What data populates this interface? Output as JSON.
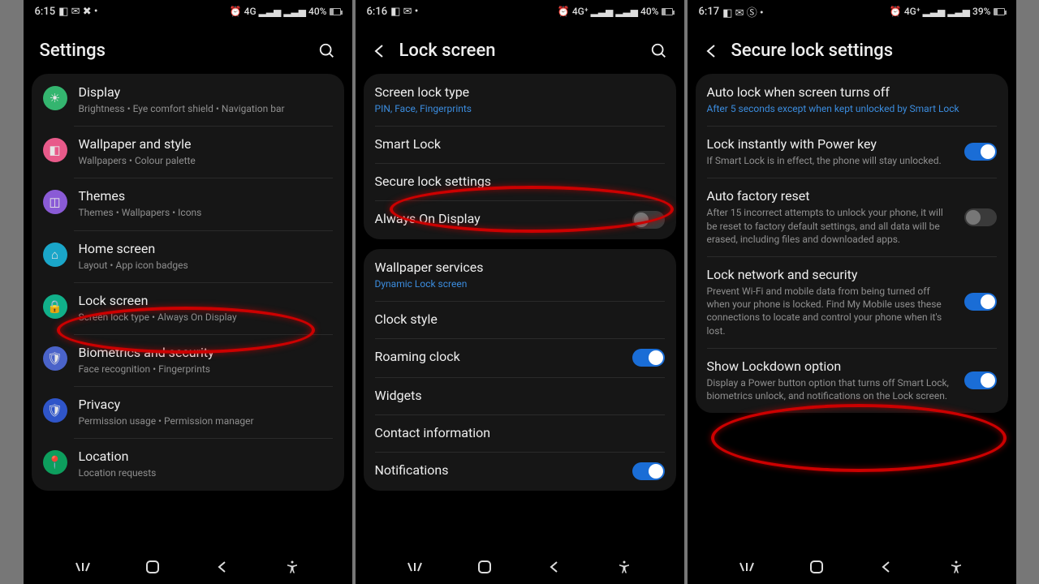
{
  "phones": {
    "settings": {
      "status": {
        "time": "6:15",
        "left_icons": "◧ ✉ ✖ •",
        "right_icons": "⏰ 4G ▂▃▅ ▂▃▅",
        "battery": "40%"
      },
      "title": "Settings",
      "items": [
        {
          "name": "display",
          "color": "#34b56f",
          "glyph": "☀",
          "title": "Display",
          "sub": "Brightness  •  Eye comfort shield  •  Navigation bar"
        },
        {
          "name": "wallpaper",
          "color": "#e85a8a",
          "glyph": "◧",
          "title": "Wallpaper and style",
          "sub": "Wallpapers  •  Colour palette"
        },
        {
          "name": "themes",
          "color": "#8a5bd6",
          "glyph": "◫",
          "title": "Themes",
          "sub": "Themes  •  Wallpapers  •  Icons"
        },
        {
          "name": "home",
          "color": "#1aa6c9",
          "glyph": "⌂",
          "title": "Home screen",
          "sub": "Layout  •  App icon badges"
        },
        {
          "name": "lockscreen",
          "color": "#11b08a",
          "glyph": "🔒",
          "title": "Lock screen",
          "sub": "Screen lock type  •  Always On Display"
        },
        {
          "name": "biometrics",
          "color": "#4a63c9",
          "glyph": "🛡",
          "title": "Biometrics and security",
          "sub": "Face recognition  •  Fingerprints"
        },
        {
          "name": "privacy",
          "color": "#2f55c9",
          "glyph": "🛡",
          "title": "Privacy",
          "sub": "Permission usage  •  Permission manager"
        },
        {
          "name": "location",
          "color": "#0d9e5d",
          "glyph": "📍",
          "title": "Location",
          "sub": "Location requests"
        }
      ]
    },
    "lockscreen": {
      "status": {
        "time": "6:16",
        "left_icons": "◧ ✉ •",
        "right_icons": "⏰ 4G⁺ ▂▃▅ ▂▃▅",
        "battery": "40%"
      },
      "title": "Lock screen",
      "group1": [
        {
          "name": "screen-lock-type",
          "title": "Screen lock type",
          "sub": "PIN, Face, Fingerprints",
          "subblue": true
        },
        {
          "name": "smart-lock",
          "title": "Smart Lock"
        },
        {
          "name": "secure-lock-settings",
          "title": "Secure lock settings"
        },
        {
          "name": "always-on-display",
          "title": "Always On Display",
          "toggle": "off"
        }
      ],
      "group2": [
        {
          "name": "wallpaper-services",
          "title": "Wallpaper services",
          "sub": "Dynamic Lock screen",
          "subblue": true
        },
        {
          "name": "clock-style",
          "title": "Clock style"
        },
        {
          "name": "roaming-clock",
          "title": "Roaming clock",
          "toggle": "on"
        },
        {
          "name": "widgets",
          "title": "Widgets"
        },
        {
          "name": "contact-information",
          "title": "Contact information"
        },
        {
          "name": "notifications",
          "title": "Notifications",
          "toggle": "on"
        }
      ]
    },
    "securelock": {
      "status": {
        "time": "6:17",
        "left_icons": "◧ ✉ Ⓢ •",
        "right_icons": "⏰ 4G⁺ ▂▃▅ ▂▃▅",
        "battery": "39%"
      },
      "title": "Secure lock settings",
      "items": [
        {
          "name": "auto-lock",
          "title": "Auto lock when screen turns off",
          "sub": "After 5 seconds except when kept unlocked by Smart Lock",
          "subblue": true
        },
        {
          "name": "lock-instantly",
          "title": "Lock instantly with Power key",
          "sub": "If Smart Lock is in effect, the phone will stay unlocked.",
          "toggle": "on"
        },
        {
          "name": "auto-factory-reset",
          "title": "Auto factory reset",
          "sub": "After 15 incorrect attempts to unlock your phone, it will be reset to factory default settings, and all data will be erased, including files and downloaded apps.",
          "toggle": "off"
        },
        {
          "name": "lock-network",
          "title": "Lock network and security",
          "sub": "Prevent Wi-Fi and mobile data from being turned off when your phone is locked. Find My Mobile uses these connections to locate and control your phone when it's lost.",
          "toggle": "on"
        },
        {
          "name": "show-lockdown",
          "title": "Show Lockdown option",
          "sub": "Display a Power button option that turns off Smart Lock, biometrics unlock, and notifications on the Lock screen.",
          "toggle": "on"
        }
      ]
    }
  }
}
